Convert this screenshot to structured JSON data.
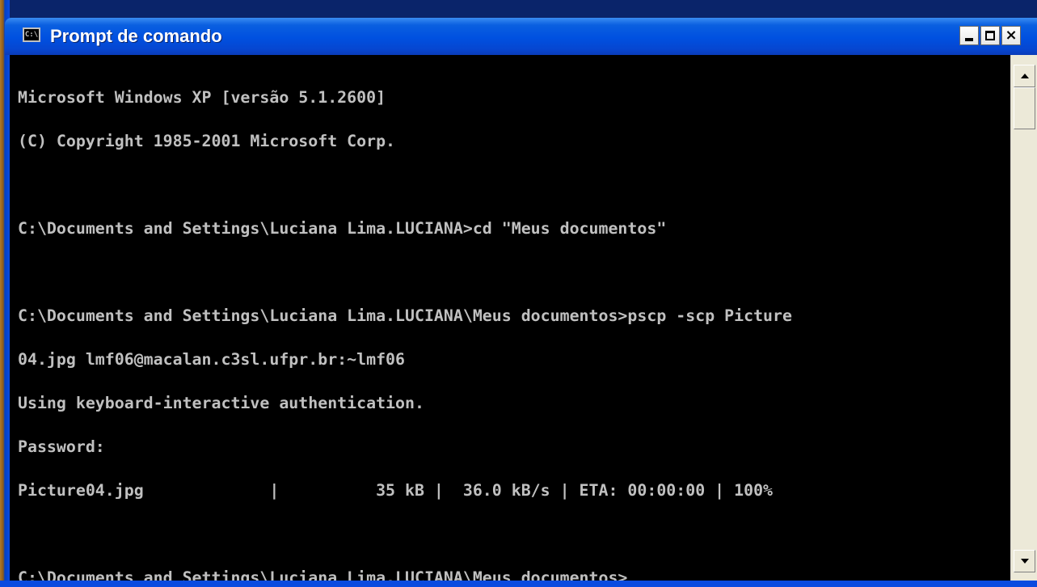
{
  "window": {
    "title": "Prompt de comando",
    "icon": "console-app-icon",
    "icon_glyph": "C:\\"
  },
  "titlebar_buttons": {
    "minimize_icon": "minimize-icon",
    "maximize_icon": "maximize-icon",
    "close_icon": "close-icon",
    "close_glyph": "×"
  },
  "console": {
    "lines": [
      "Microsoft Windows XP [versão 5.1.2600]",
      "(C) Copyright 1985-2001 Microsoft Corp.",
      "",
      "C:\\Documents and Settings\\Luciana Lima.LUCIANA>cd \"Meus documentos\"",
      "",
      "C:\\Documents and Settings\\Luciana Lima.LUCIANA\\Meus documentos>pscp -scp Picture",
      "04.jpg lmf06@macalan.c3sl.ufpr.br:~lmf06",
      "Using keyboard-interactive authentication.",
      "Password:",
      "Picture04.jpg             |          35 kB |  36.0 kB/s | ETA: 00:00:00 | 100%",
      "",
      "C:\\Documents and Settings\\Luciana Lima.LUCIANA\\Meus documentos>"
    ]
  },
  "scrollbar": {
    "up_icon": "scroll-up-arrow-icon",
    "down_icon": "scroll-down-arrow-icon"
  }
}
